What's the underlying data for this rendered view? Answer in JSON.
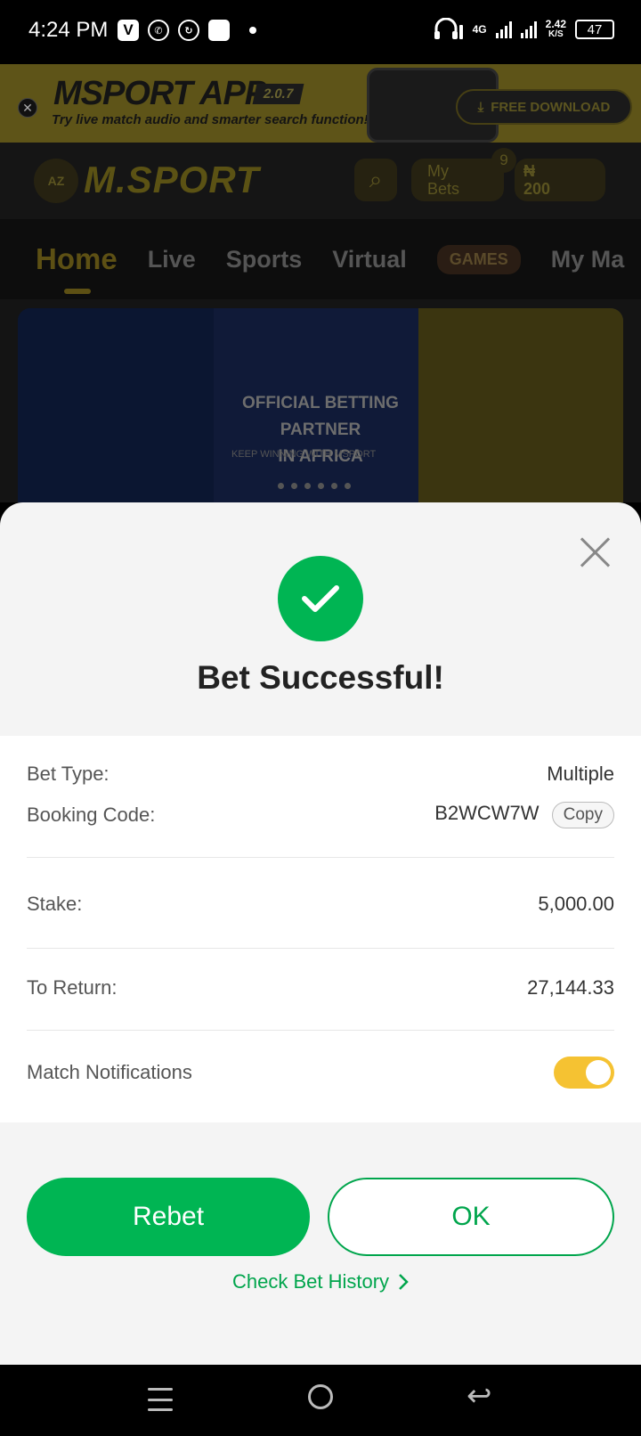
{
  "status_bar": {
    "time": "4:24 PM",
    "network": "4G",
    "speed_value": "2.42",
    "speed_unit": "K/S",
    "battery": "47"
  },
  "promo": {
    "title": "MSPORT APP",
    "version": "2.0.7",
    "subtitle": "Try live match audio and smarter search function!",
    "download_label": "FREE DOWNLOAD"
  },
  "header": {
    "logo": "M.SPORT",
    "az_label": "AZ",
    "my_bets_line1": "My",
    "my_bets_line2": "Bets",
    "my_bets_count": "9",
    "currency": "₦",
    "balance": "200"
  },
  "tabs": [
    "Home",
    "Live",
    "Sports",
    "Virtual",
    "GAMES",
    "My Ma"
  ],
  "banner": {
    "title_line1": "OFFICIAL BETTING PARTNER",
    "title_line2": "IN AFRICA",
    "tagline": "KEEP WINNING WITH MSPORT"
  },
  "sheet": {
    "title": "Bet Successful!",
    "bet_type_label": "Bet Type:",
    "bet_type_value": "Multiple",
    "booking_label": "Booking Code:",
    "booking_value": "B2WCW7W",
    "copy_label": "Copy",
    "stake_label": "Stake:",
    "stake_value": "5,000.00",
    "return_label": "To Return:",
    "return_value": "27,144.33",
    "notifications_label": "Match Notifications",
    "notifications_on": true,
    "rebet_label": "Rebet",
    "ok_label": "OK",
    "history_label": "Check Bet History"
  },
  "colors": {
    "accent_green": "#00b553",
    "toggle_yellow": "#f5c232"
  }
}
